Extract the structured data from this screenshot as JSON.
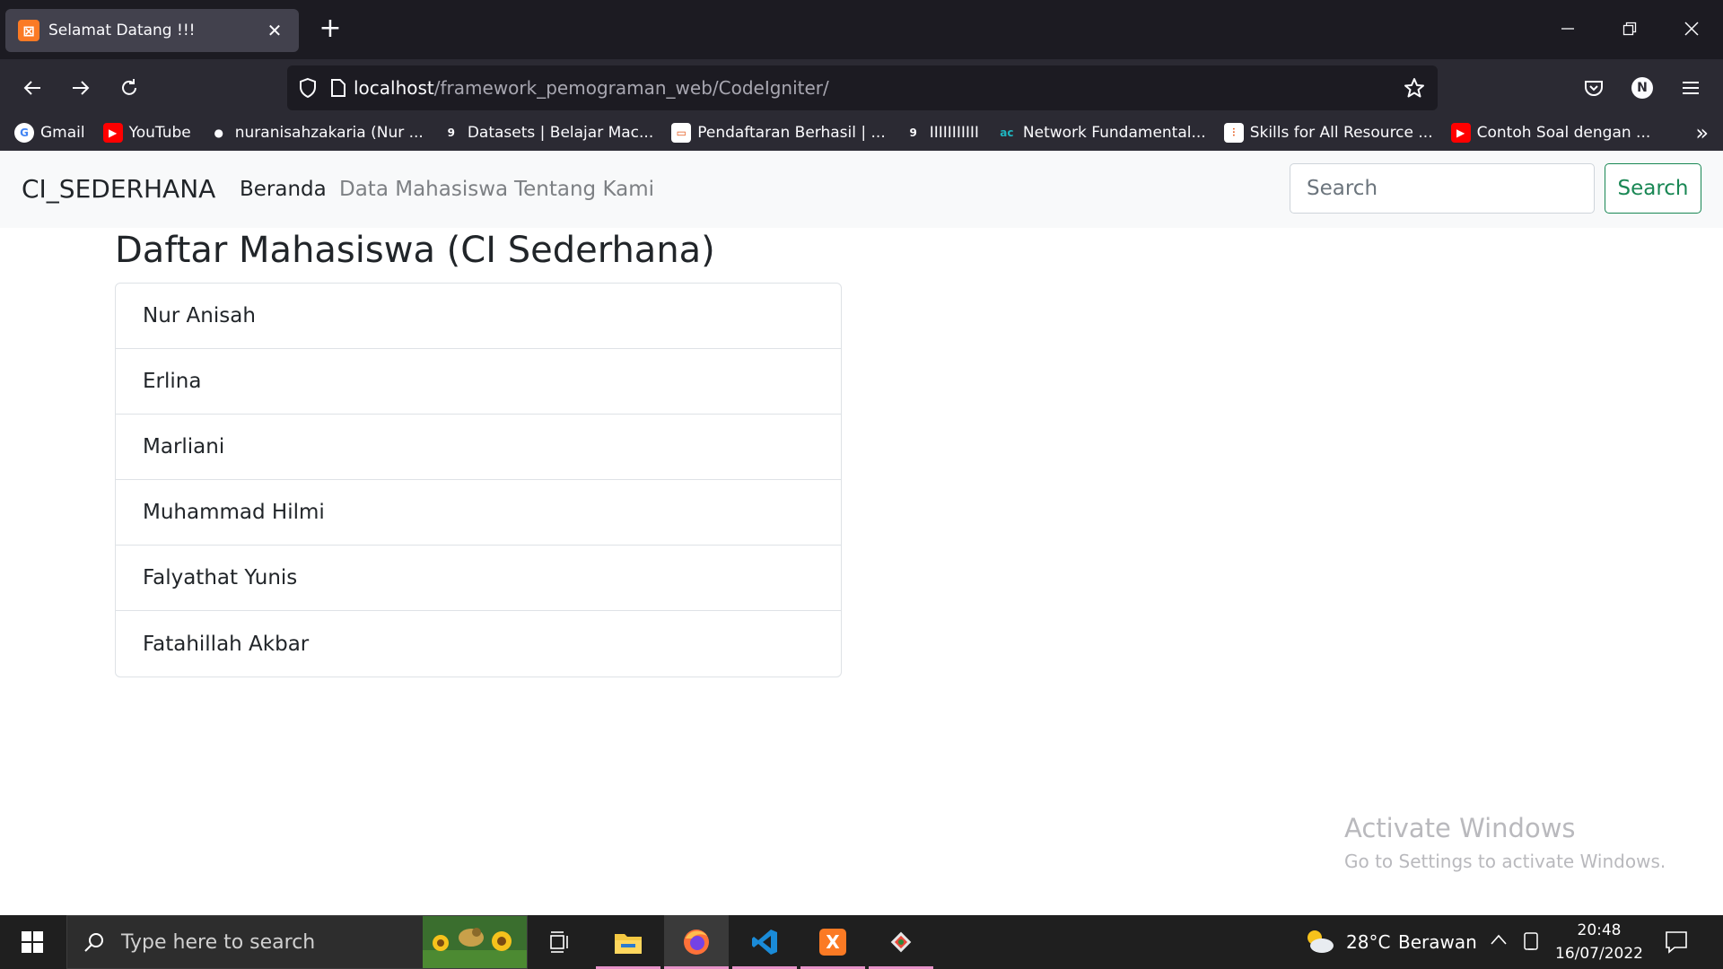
{
  "browser": {
    "tab_title": "Selamat Datang !!!",
    "url_host": "localhost",
    "url_path": "/framework_pemograman_web/CodeIgniter/",
    "account_initial": "N",
    "bookmarks": [
      {
        "label": "Gmail",
        "icon": "google-icon",
        "color": "#ffffff"
      },
      {
        "label": "YouTube",
        "icon": "youtube-icon",
        "color": "#ff0000"
      },
      {
        "label": "nuranisahzakaria (Nur ...",
        "icon": "github-icon",
        "color": "#fbfbfe"
      },
      {
        "label": "Datasets | Belajar Mac...",
        "icon": "g-icon",
        "color": "#fbfbfe"
      },
      {
        "label": "Pendaftaran Berhasil | ...",
        "icon": "page-icon",
        "color": "#ffffff"
      },
      {
        "label": "IIIIIIIIIII",
        "icon": "g-icon",
        "color": "#fbfbfe"
      },
      {
        "label": "Network Fundamental...",
        "icon": "ac-icon",
        "color": "#1fb6c1"
      },
      {
        "label": "Skills for All Resource ...",
        "icon": "cisco-icon",
        "color": "#ffffff"
      },
      {
        "label": "Contoh Soal dengan ...",
        "icon": "youtube-icon",
        "color": "#ff0000"
      }
    ]
  },
  "site": {
    "brand": "CI_SEDERHANA",
    "nav": [
      {
        "label": "Beranda",
        "active": true
      },
      {
        "label": "Data Mahasiswa",
        "active": false
      },
      {
        "label": "Tentang Kami",
        "active": false
      }
    ],
    "search_placeholder": "Search",
    "search_button": "Search",
    "heading": "Daftar Mahasiswa (CI Sederhana)",
    "students": [
      "Nur Anisah",
      "Erlina",
      "Marliani",
      "Muhammad Hilmi",
      "Falyathat Yunis",
      "Fatahillah Akbar"
    ]
  },
  "watermark": {
    "title": "Activate Windows",
    "subtitle": "Go to Settings to activate Windows."
  },
  "taskbar": {
    "search_placeholder": "Type here to search",
    "weather_temp": "28°C",
    "weather_desc": "Berawan",
    "time": "20:48",
    "date": "16/07/2022"
  }
}
